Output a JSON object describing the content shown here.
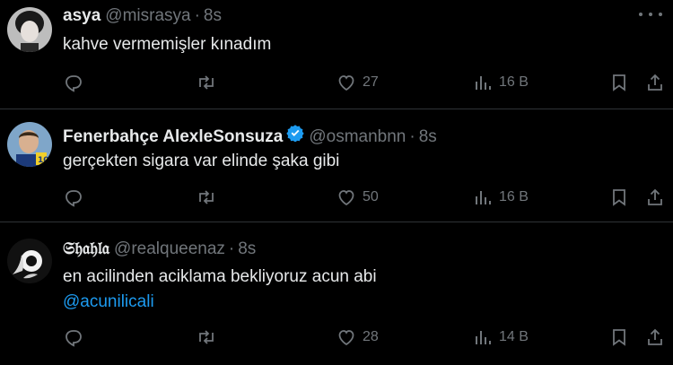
{
  "tweets": [
    {
      "name": "asya",
      "handle": "@misrasya",
      "dot": "·",
      "time": "8s",
      "text": "kahve vermemişler kınadım",
      "mention": "",
      "likes": "27",
      "views": "16 B",
      "avatar_color": "#c9c9c9"
    },
    {
      "name": "Fenerbahçe AlexleSonsuza",
      "handle": "@osmanbnn",
      "dot": "·",
      "time": "8s",
      "text": "gerçekten sigara var elinde şaka gibi",
      "mention": "",
      "likes": "50",
      "views": "16 B",
      "avatar_color": "#d9b84a"
    },
    {
      "name": "𝔖𝔥𝔞𝔥𝔩𝔞",
      "handle": "@realqueenaz",
      "dot": "·",
      "time": "8s",
      "text": "en acilinden aciklama bekliyoruz acun abi",
      "mention": "@acunilicali",
      "likes": "28",
      "views": "14 B",
      "avatar_color": "#1a1a1a"
    }
  ],
  "colors": {
    "background": "#000000",
    "text": "#e7e9ea",
    "muted": "#71767b",
    "accent": "#1d9bf0",
    "divider": "#2f3336"
  },
  "icons": [
    "more-icon",
    "reply-icon",
    "retweet-icon",
    "like-icon",
    "views-icon",
    "bookmark-icon",
    "share-icon",
    "verified-badge-icon"
  ]
}
